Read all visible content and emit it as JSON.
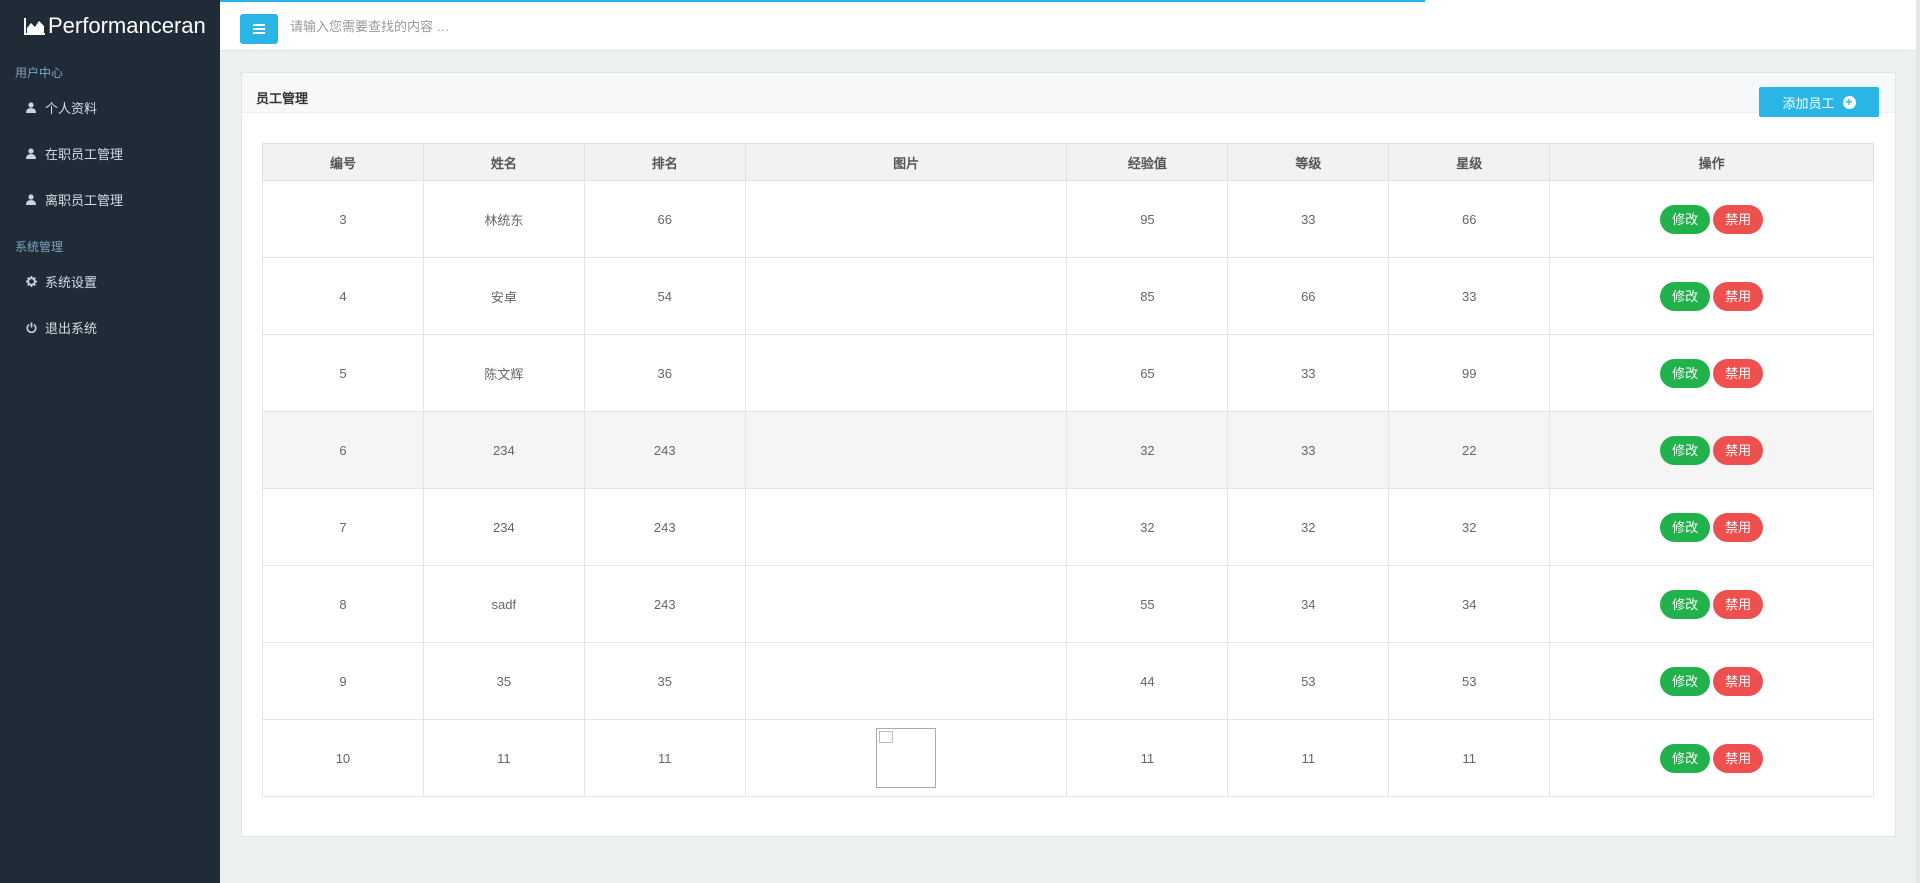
{
  "app": {
    "brand": "Performanceran"
  },
  "sidebar": {
    "sections": [
      {
        "title": "用户中心",
        "items": [
          {
            "label": "个人资料",
            "icon": "user-icon"
          },
          {
            "label": "在职员工管理",
            "icon": "user-icon"
          },
          {
            "label": "离职员工管理",
            "icon": "user-icon"
          }
        ]
      },
      {
        "title": "系统管理",
        "items": [
          {
            "label": "系统设置",
            "icon": "gear-icon"
          },
          {
            "label": "退出系统",
            "icon": "power-icon"
          }
        ]
      }
    ]
  },
  "topbar": {
    "search_placeholder": "请输入您需要查找的内容 …",
    "menu_icon": "menu-icon"
  },
  "panel": {
    "title": "员工管理",
    "add_label": "添加员工"
  },
  "table": {
    "headers": [
      "编号",
      "姓名",
      "排名",
      "图片",
      "经验值",
      "等级",
      "星级",
      "操作"
    ],
    "rows": [
      {
        "id": "3",
        "name": "林统东",
        "rank": "66",
        "image": false,
        "exp": "95",
        "level": "33",
        "stars": "66"
      },
      {
        "id": "4",
        "name": "安卓",
        "rank": "54",
        "image": false,
        "exp": "85",
        "level": "66",
        "stars": "33"
      },
      {
        "id": "5",
        "name": "陈文辉",
        "rank": "36",
        "image": false,
        "exp": "65",
        "level": "33",
        "stars": "99"
      },
      {
        "id": "6",
        "name": "234",
        "rank": "243",
        "image": false,
        "exp": "32",
        "level": "33",
        "stars": "22",
        "highlighted": true
      },
      {
        "id": "7",
        "name": "234",
        "rank": "243",
        "image": false,
        "exp": "32",
        "level": "32",
        "stars": "32"
      },
      {
        "id": "8",
        "name": "sadf",
        "rank": "243",
        "image": false,
        "exp": "55",
        "level": "34",
        "stars": "34"
      },
      {
        "id": "9",
        "name": "35",
        "rank": "35",
        "image": false,
        "exp": "44",
        "level": "53",
        "stars": "53"
      },
      {
        "id": "10",
        "name": "11",
        "rank": "11",
        "image": true,
        "exp": "11",
        "level": "11",
        "stars": "11"
      }
    ],
    "actions": {
      "edit": "修改",
      "disable": "禁用"
    }
  },
  "colors": {
    "accent": "#29b6e6",
    "sidebar_bg": "#1f2b36",
    "edit": "#22b24c",
    "disable": "#ee4f4f"
  }
}
